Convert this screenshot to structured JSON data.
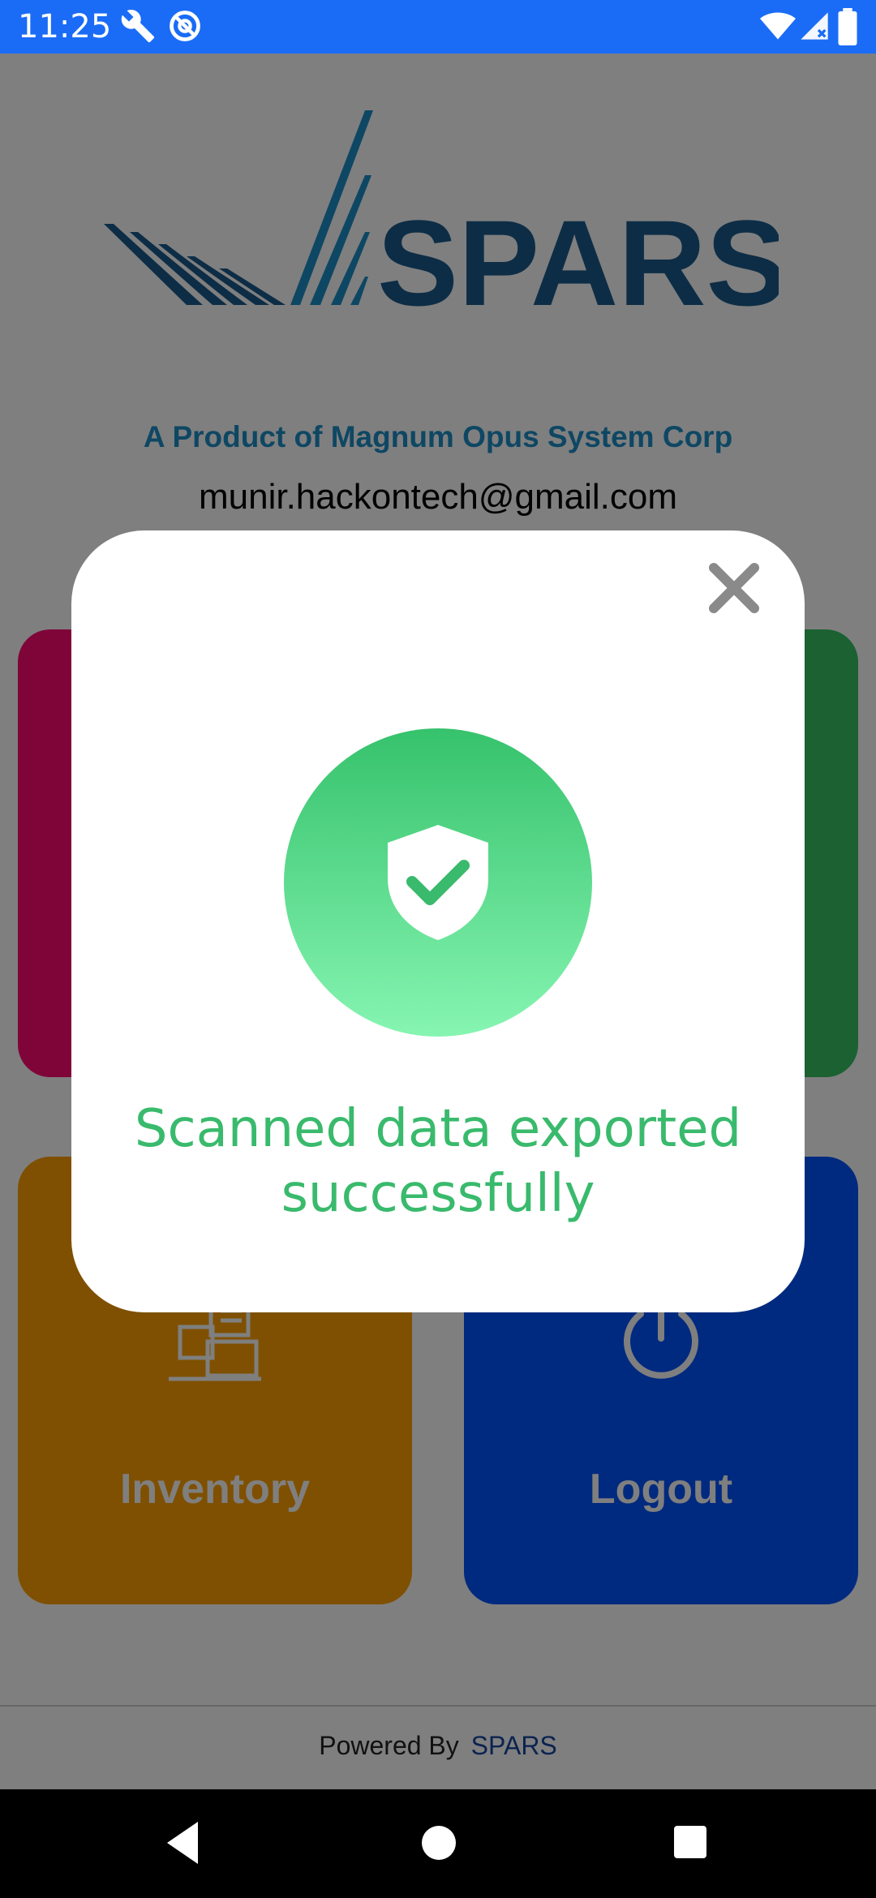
{
  "status_bar": {
    "time": "11:25",
    "icons": [
      "wrench-icon",
      "no-location-icon",
      "wifi-icon",
      "signal-icon",
      "battery-icon"
    ]
  },
  "header": {
    "logo_text": "SPARS",
    "tagline": "A Product of Magnum Opus System Corp",
    "user_email": "munir.hackontech@gmail.com"
  },
  "tiles": [
    {
      "label": "",
      "color": "#ff0a73"
    },
    {
      "label": "",
      "color": "#36c265"
    },
    {
      "label": "Inventory",
      "icon": "boxes-icon",
      "color": "#ffa102"
    },
    {
      "label": "Logout",
      "icon": "power-icon",
      "color": "#0154ff"
    }
  ],
  "footer": {
    "powered_by": "Powered By",
    "brand": "SPARS"
  },
  "dialog": {
    "icon": "shield-check-icon",
    "message": "Scanned data exported successfully",
    "message_color": "#39ba6c",
    "close_icon": "close-icon"
  },
  "navigation": {
    "buttons": [
      "back-icon",
      "home-icon",
      "recents-icon"
    ]
  }
}
